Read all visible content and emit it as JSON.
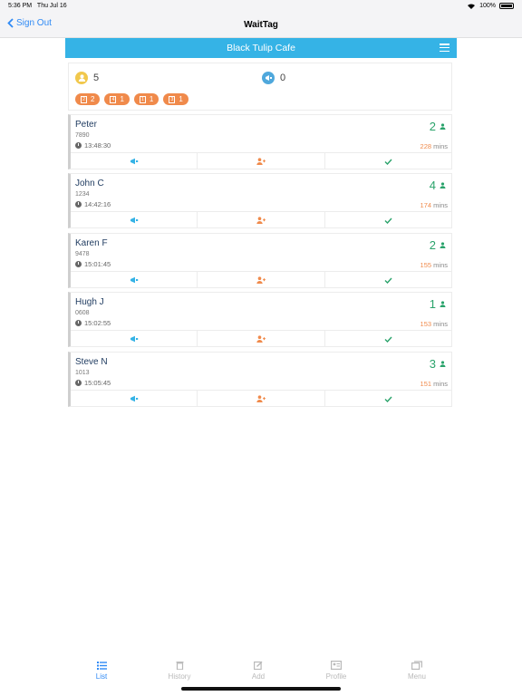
{
  "status": {
    "time": "5:36 PM",
    "date": "Thu Jul 16",
    "battery": "100%"
  },
  "nav": {
    "back_label": "Sign Out",
    "title": "WaitTag"
  },
  "cafe": {
    "name": "Black Tulip Cafe"
  },
  "summary": {
    "waiting_count": "5",
    "notified_count": "0",
    "chips": [
      {
        "size": "2",
        "count": "2"
      },
      {
        "size": "4",
        "count": "1"
      },
      {
        "size": "1",
        "count": "1"
      },
      {
        "size": "3",
        "count": "1"
      }
    ]
  },
  "guests": [
    {
      "name": "Peter",
      "code": "7890",
      "time": "13:48:30",
      "party": "2",
      "wait": "228",
      "unit": "mins"
    },
    {
      "name": "John C",
      "code": "1234",
      "time": "14:42:16",
      "party": "4",
      "wait": "174",
      "unit": "mins"
    },
    {
      "name": "Karen F",
      "code": "9478",
      "time": "15:01:45",
      "party": "2",
      "wait": "155",
      "unit": "mins"
    },
    {
      "name": "Hugh J",
      "code": "0608",
      "time": "15:02:55",
      "party": "1",
      "wait": "153",
      "unit": "mins"
    },
    {
      "name": "Steve N",
      "code": "1013",
      "time": "15:05:45",
      "party": "3",
      "wait": "151",
      "unit": "mins"
    }
  ],
  "tabs": [
    {
      "label": "List",
      "icon": "list-icon"
    },
    {
      "label": "History",
      "icon": "trash-icon"
    },
    {
      "label": "Add",
      "icon": "edit-icon"
    },
    {
      "label": "Profile",
      "icon": "profile-card-icon"
    },
    {
      "label": "Menu",
      "icon": "menu-book-icon"
    }
  ],
  "colors": {
    "accent": "#35b3e6",
    "orange": "#f08a4b",
    "green": "#2aa36b",
    "tab_active": "#2f8af5"
  }
}
